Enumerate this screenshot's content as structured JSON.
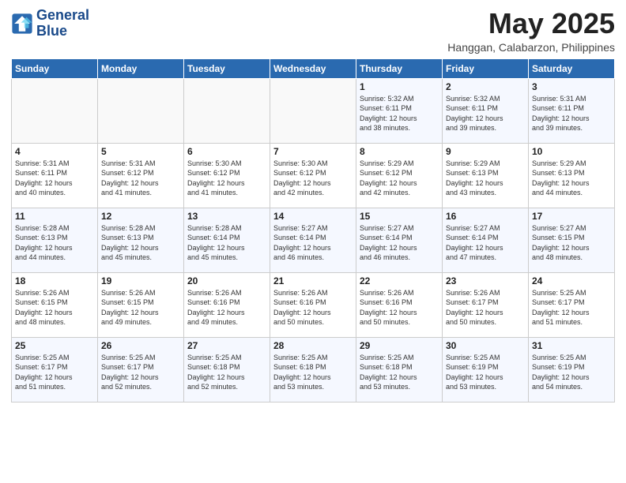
{
  "logo": {
    "line1": "General",
    "line2": "Blue"
  },
  "title": "May 2025",
  "location": "Hanggan, Calabarzon, Philippines",
  "weekdays": [
    "Sunday",
    "Monday",
    "Tuesday",
    "Wednesday",
    "Thursday",
    "Friday",
    "Saturday"
  ],
  "weeks": [
    [
      {
        "day": "",
        "info": ""
      },
      {
        "day": "",
        "info": ""
      },
      {
        "day": "",
        "info": ""
      },
      {
        "day": "",
        "info": ""
      },
      {
        "day": "1",
        "info": "Sunrise: 5:32 AM\nSunset: 6:11 PM\nDaylight: 12 hours\nand 38 minutes."
      },
      {
        "day": "2",
        "info": "Sunrise: 5:32 AM\nSunset: 6:11 PM\nDaylight: 12 hours\nand 39 minutes."
      },
      {
        "day": "3",
        "info": "Sunrise: 5:31 AM\nSunset: 6:11 PM\nDaylight: 12 hours\nand 39 minutes."
      }
    ],
    [
      {
        "day": "4",
        "info": "Sunrise: 5:31 AM\nSunset: 6:11 PM\nDaylight: 12 hours\nand 40 minutes."
      },
      {
        "day": "5",
        "info": "Sunrise: 5:31 AM\nSunset: 6:12 PM\nDaylight: 12 hours\nand 41 minutes."
      },
      {
        "day": "6",
        "info": "Sunrise: 5:30 AM\nSunset: 6:12 PM\nDaylight: 12 hours\nand 41 minutes."
      },
      {
        "day": "7",
        "info": "Sunrise: 5:30 AM\nSunset: 6:12 PM\nDaylight: 12 hours\nand 42 minutes."
      },
      {
        "day": "8",
        "info": "Sunrise: 5:29 AM\nSunset: 6:12 PM\nDaylight: 12 hours\nand 42 minutes."
      },
      {
        "day": "9",
        "info": "Sunrise: 5:29 AM\nSunset: 6:13 PM\nDaylight: 12 hours\nand 43 minutes."
      },
      {
        "day": "10",
        "info": "Sunrise: 5:29 AM\nSunset: 6:13 PM\nDaylight: 12 hours\nand 44 minutes."
      }
    ],
    [
      {
        "day": "11",
        "info": "Sunrise: 5:28 AM\nSunset: 6:13 PM\nDaylight: 12 hours\nand 44 minutes."
      },
      {
        "day": "12",
        "info": "Sunrise: 5:28 AM\nSunset: 6:13 PM\nDaylight: 12 hours\nand 45 minutes."
      },
      {
        "day": "13",
        "info": "Sunrise: 5:28 AM\nSunset: 6:14 PM\nDaylight: 12 hours\nand 45 minutes."
      },
      {
        "day": "14",
        "info": "Sunrise: 5:27 AM\nSunset: 6:14 PM\nDaylight: 12 hours\nand 46 minutes."
      },
      {
        "day": "15",
        "info": "Sunrise: 5:27 AM\nSunset: 6:14 PM\nDaylight: 12 hours\nand 46 minutes."
      },
      {
        "day": "16",
        "info": "Sunrise: 5:27 AM\nSunset: 6:14 PM\nDaylight: 12 hours\nand 47 minutes."
      },
      {
        "day": "17",
        "info": "Sunrise: 5:27 AM\nSunset: 6:15 PM\nDaylight: 12 hours\nand 48 minutes."
      }
    ],
    [
      {
        "day": "18",
        "info": "Sunrise: 5:26 AM\nSunset: 6:15 PM\nDaylight: 12 hours\nand 48 minutes."
      },
      {
        "day": "19",
        "info": "Sunrise: 5:26 AM\nSunset: 6:15 PM\nDaylight: 12 hours\nand 49 minutes."
      },
      {
        "day": "20",
        "info": "Sunrise: 5:26 AM\nSunset: 6:16 PM\nDaylight: 12 hours\nand 49 minutes."
      },
      {
        "day": "21",
        "info": "Sunrise: 5:26 AM\nSunset: 6:16 PM\nDaylight: 12 hours\nand 50 minutes."
      },
      {
        "day": "22",
        "info": "Sunrise: 5:26 AM\nSunset: 6:16 PM\nDaylight: 12 hours\nand 50 minutes."
      },
      {
        "day": "23",
        "info": "Sunrise: 5:26 AM\nSunset: 6:17 PM\nDaylight: 12 hours\nand 50 minutes."
      },
      {
        "day": "24",
        "info": "Sunrise: 5:25 AM\nSunset: 6:17 PM\nDaylight: 12 hours\nand 51 minutes."
      }
    ],
    [
      {
        "day": "25",
        "info": "Sunrise: 5:25 AM\nSunset: 6:17 PM\nDaylight: 12 hours\nand 51 minutes."
      },
      {
        "day": "26",
        "info": "Sunrise: 5:25 AM\nSunset: 6:17 PM\nDaylight: 12 hours\nand 52 minutes."
      },
      {
        "day": "27",
        "info": "Sunrise: 5:25 AM\nSunset: 6:18 PM\nDaylight: 12 hours\nand 52 minutes."
      },
      {
        "day": "28",
        "info": "Sunrise: 5:25 AM\nSunset: 6:18 PM\nDaylight: 12 hours\nand 53 minutes."
      },
      {
        "day": "29",
        "info": "Sunrise: 5:25 AM\nSunset: 6:18 PM\nDaylight: 12 hours\nand 53 minutes."
      },
      {
        "day": "30",
        "info": "Sunrise: 5:25 AM\nSunset: 6:19 PM\nDaylight: 12 hours\nand 53 minutes."
      },
      {
        "day": "31",
        "info": "Sunrise: 5:25 AM\nSunset: 6:19 PM\nDaylight: 12 hours\nand 54 minutes."
      }
    ]
  ]
}
